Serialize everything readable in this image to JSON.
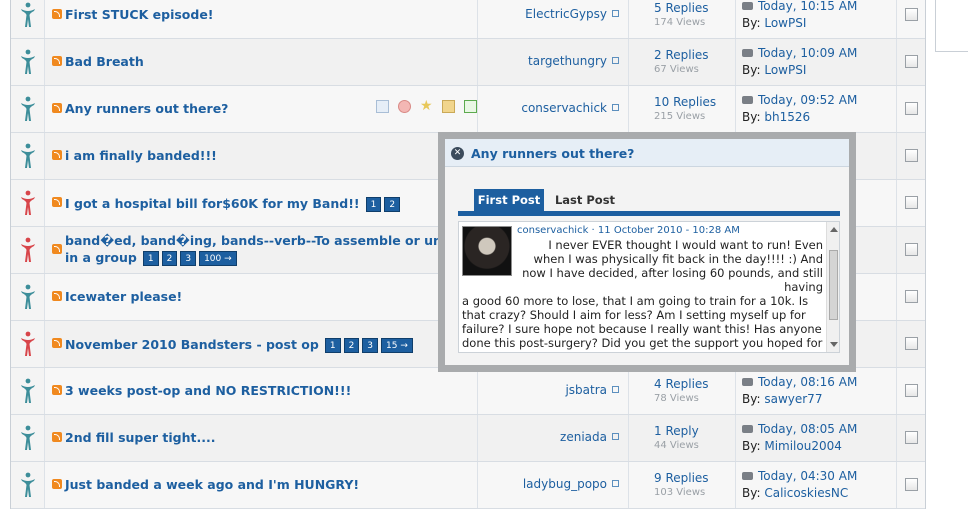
{
  "threads": [
    {
      "title": "First STUCK episode!",
      "author": "ElectricGypsy",
      "replies": "5 Replies",
      "views": "174 Views",
      "last_date": "Today, 10:15 AM",
      "last_by": "LowPSI",
      "icon_color": "#3d8e9a",
      "pages": []
    },
    {
      "title": "Bad Breath",
      "author": "targethungry",
      "replies": "2 Replies",
      "views": "67 Views",
      "last_date": "Today, 10:09 AM",
      "last_by": "LowPSI",
      "icon_color": "#3d8e9a",
      "pages": []
    },
    {
      "title": "Any runners out there?",
      "author": "conservachick",
      "replies": "10 Replies",
      "views": "215 Views",
      "last_date": "Today, 09:52 AM",
      "last_by": "bh1526",
      "icon_color": "#3d8e9a",
      "pages": []
    },
    {
      "title": "i am finally banded!!!",
      "author": "",
      "replies": "",
      "views": "",
      "last_date": "",
      "last_by": "",
      "icon_color": "#3d8e9a",
      "pages": []
    },
    {
      "title": "I got a hospital bill for$60K for my Band!!",
      "author": "",
      "replies": "",
      "views": "",
      "last_date": "",
      "last_by": "",
      "icon_color": "#d8454a",
      "pages": [
        "1",
        "2"
      ]
    },
    {
      "title": "band�ed, band�ing, bands--verb--To assemble or unite in a group",
      "author": "",
      "replies": "",
      "views": "",
      "last_date": "",
      "last_by": "",
      "icon_color": "#d8454a",
      "pages": [
        "1",
        "2",
        "3",
        "100 →"
      ]
    },
    {
      "title": "Icewater please!",
      "author": "",
      "replies": "",
      "views": "",
      "last_date": "",
      "last_by": "",
      "icon_color": "#3d8e9a",
      "pages": []
    },
    {
      "title": "November 2010 Bandsters - post op",
      "author": "",
      "replies": "",
      "views": "",
      "last_date": "",
      "last_by": "",
      "icon_color": "#d8454a",
      "pages": [
        "1",
        "2",
        "3",
        "15 →"
      ]
    },
    {
      "title": "3 weeks post-op and NO RESTRICTION!!!",
      "author": "jsbatra",
      "replies": "4 Replies",
      "views": "78 Views",
      "last_date": "Today, 08:16 AM",
      "last_by": "sawyer77",
      "icon_color": "#3d8e9a",
      "pages": []
    },
    {
      "title": "2nd fill super tight....",
      "author": "zeniada",
      "replies": "1 Reply",
      "views": "44 Views",
      "last_date": "Today, 08:05 AM",
      "last_by": "Mimilou2004",
      "icon_color": "#3d8e9a",
      "pages": []
    },
    {
      "title": "Just banded a week ago and I'm HUNGRY!",
      "author": "ladybug_popo",
      "replies": "9 Replies",
      "views": "103 Views",
      "last_date": "Today, 04:30 AM",
      "last_by": "CalicoskiesNC",
      "icon_color": "#3d8e9a",
      "pages": []
    }
  ],
  "by_label": "By:",
  "popup": {
    "title": "Any runners out there?",
    "close_icon": "close-icon",
    "tab_first": "First Post",
    "tab_last": "Last Post",
    "meta": "conservachick · 11 October 2010 - 10:28 AM",
    "text_p1": "I never EVER thought I would want to run! Even when I was physically fit back in the day!!!! :) And now I have decided, after losing 60 pounds, and still having",
    "text_p2": "a good 60 more to lose, that I am going to train for a 10k. Is that crazy? Should I aim for less? Am I setting myself up for failure? I sure hope not because I really want this! Has anyone done this post-surgery? Did you get the support you hoped for from family and friends? Just curious if anyo"
  },
  "colors": {
    "link": "#1d5fa0",
    "accent": "#1d5fa0",
    "sticky_red": "#d8454a",
    "normal_teal": "#3d8e9a"
  }
}
